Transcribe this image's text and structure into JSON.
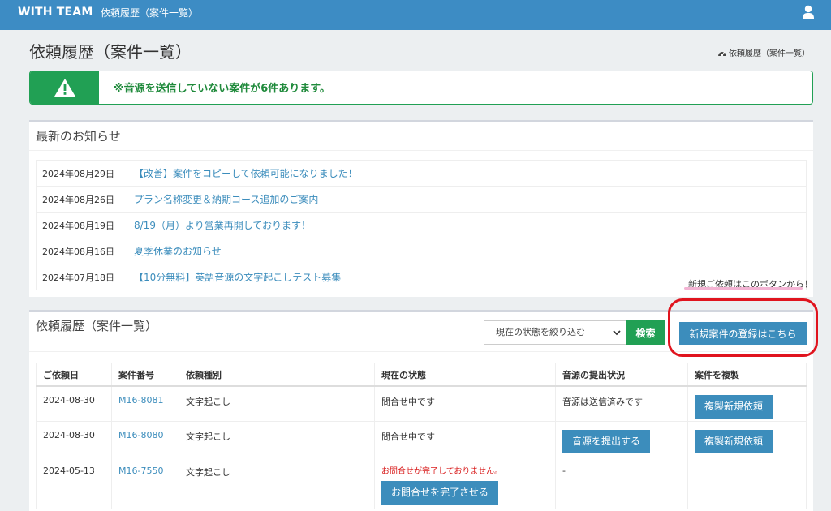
{
  "navbar": {
    "brand": "WITH TEAM",
    "link": "依頼履歴（案件一覧）"
  },
  "page": {
    "title": "依頼履歴（案件一覧）",
    "breadcrumb": "依頼履歴（案件一覧）"
  },
  "alert": {
    "text": "※音源を送信していない案件が6件あります。"
  },
  "news": {
    "title": "最新のお知らせ",
    "items": [
      {
        "date": "2024年08月29日",
        "title": "【改善】案件をコピーして依頼可能になりました！"
      },
      {
        "date": "2024年08月26日",
        "title": "プラン名称変更＆納期コース追加のご案内"
      },
      {
        "date": "2024年08月19日",
        "title": "8/19（月）より営業再開しております！"
      },
      {
        "date": "2024年08月16日",
        "title": "夏季休業のお知らせ"
      },
      {
        "date": "2024年07月18日",
        "title": "【10分無料】英語音源の文字起こしテスト募集"
      }
    ],
    "hint": "新規ご依頼はこのボタンから！"
  },
  "cases": {
    "title": "依頼履歴（案件一覧）",
    "filter_placeholder": "現在の状態を絞り込む",
    "search_label": "検索",
    "new_label": "新規案件の登録はこちら",
    "headers": [
      "ご依頼日",
      "案件番号",
      "依頼種別",
      "現在の状態",
      "音源の提出状況",
      "案件を複製"
    ],
    "rows": [
      {
        "date": "2024-08-30",
        "id": "M16-8081",
        "type": "文字起こし",
        "status": "問合せ中です",
        "audio": "音源は送信済みです",
        "copy_label": "複製新規依頼"
      },
      {
        "date": "2024-08-30",
        "id": "M16-8080",
        "type": "文字起こし",
        "status": "問合せ中です",
        "audio_button": "音源を提出する",
        "copy_label": "複製新規依頼"
      },
      {
        "date": "2024-05-13",
        "id": "M16-7550",
        "type": "文字起こし",
        "status_warning": "お問合せが完了しておりません。",
        "status_button": "お問合せを完了させる",
        "audio": "-"
      }
    ]
  },
  "colors": {
    "navbar": "#3d8cc4",
    "success": "#21a054",
    "primary": "#3c8dbc",
    "annotation": "#e0141e"
  },
  "icons": {
    "user": "user-icon",
    "warning": "warning-triangle-icon",
    "breadcrumb": "dashboard-icon"
  }
}
